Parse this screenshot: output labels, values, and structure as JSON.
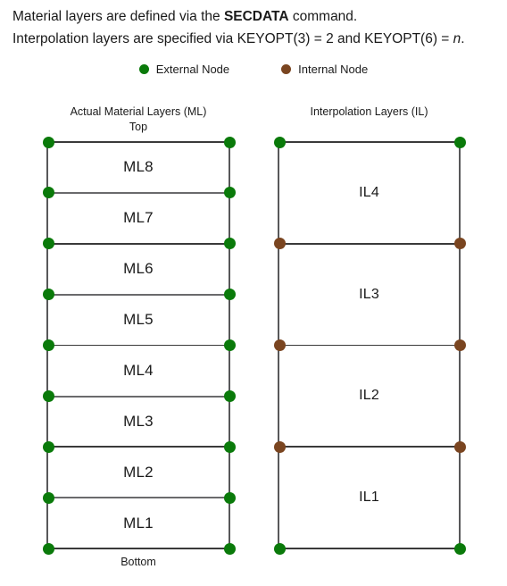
{
  "header": {
    "line1_part1": "Material layers are defined via the ",
    "line1_bold": "SECDATA",
    "line1_part2": " command.",
    "line2_part1": "Interpolation layers are specified via KEYOPT(3) = 2 and KEYOPT(6) = ",
    "line2_italic": "n",
    "line2_part2": "."
  },
  "legend": {
    "items": [
      {
        "label": "External Node",
        "color": "#0a7a0a",
        "icon": "circle-marker-icon"
      },
      {
        "label": "Internal Node",
        "color": "#7a4520",
        "icon": "circle-marker-icon"
      }
    ]
  },
  "colors": {
    "external_node": "#0a7a0a",
    "internal_node": "#7a4520",
    "rail": "#58585a",
    "divider": "#3a3a3a",
    "text": "#1a1a1a"
  },
  "ml_column": {
    "title": "Actual Material Layers (ML)",
    "top_label": "Top",
    "bottom_label": "Bottom",
    "layer_count": 8,
    "layers": [
      {
        "label": "ML8"
      },
      {
        "label": "ML7"
      },
      {
        "label": "ML6"
      },
      {
        "label": "ML5"
      },
      {
        "label": "ML4"
      },
      {
        "label": "ML3"
      },
      {
        "label": "ML2"
      },
      {
        "label": "ML1"
      }
    ],
    "node_rows": [
      {
        "type": "external"
      },
      {
        "type": "external"
      },
      {
        "type": "external"
      },
      {
        "type": "external"
      },
      {
        "type": "external"
      },
      {
        "type": "external"
      },
      {
        "type": "external"
      },
      {
        "type": "external"
      },
      {
        "type": "external"
      }
    ]
  },
  "il_column": {
    "title": "Interpolation Layers (IL)",
    "layer_count": 4,
    "layers": [
      {
        "label": "IL4"
      },
      {
        "label": "IL3"
      },
      {
        "label": "IL2"
      },
      {
        "label": "IL1"
      }
    ],
    "node_rows": [
      {
        "type": "external"
      },
      {
        "type": "internal"
      },
      {
        "type": "internal"
      },
      {
        "type": "internal"
      },
      {
        "type": "external"
      }
    ]
  }
}
